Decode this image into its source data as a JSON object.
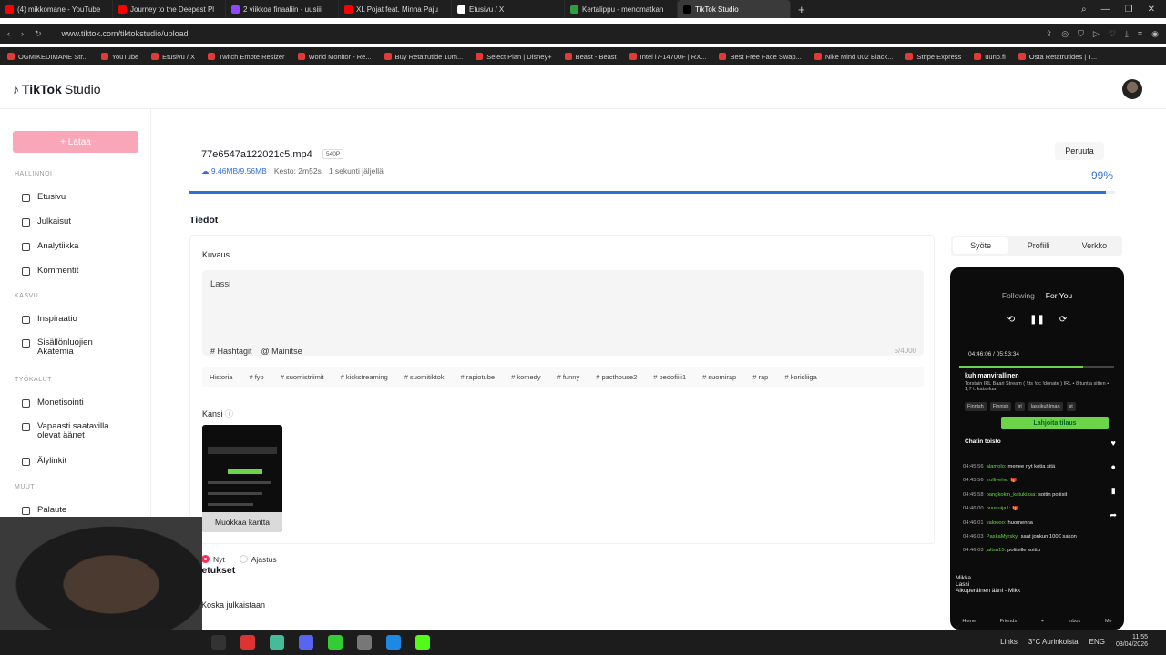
{
  "browser": {
    "tabs": [
      {
        "label": "(4) mikkomane - YouTube",
        "color": "#ff0000"
      },
      {
        "label": "Journey to the Deepest Pl",
        "color": "#ff0000"
      },
      {
        "label": "2 viikkoa finaaliin - uusiii",
        "color": "#9147ff"
      },
      {
        "label": "XL Pojat feat. Minna Paju",
        "color": "#ff0000"
      },
      {
        "label": "Etusivu / X",
        "color": "#ffffff"
      },
      {
        "label": "Kertalippu - menomatkan",
        "color": "#2e9e3f"
      },
      {
        "label": "TikTok Studio",
        "color": "#000000",
        "active": true
      }
    ],
    "url": "www.tiktok.com/tiktokstudio/upload",
    "bookmarks": [
      "OGMIKEDIMANE Str...",
      "YouTube",
      "Etusivu / X",
      "Twitch Emote Resizer",
      "World Monitor - Re...",
      "Buy Retatrutide 10m...",
      "Select Plan | Disney+",
      "Beast - Beast",
      "Intel i7-14700F | RX...",
      "Best Free Face Swap...",
      "Nike Mind 002 Black...",
      "Stripe Express",
      "uuno.fi",
      "Osta Retatrutides | T..."
    ]
  },
  "app": {
    "logo": "TikTok",
    "logo_suffix": "Studio",
    "upload_label": "+ Lataa",
    "sections": {
      "manage": "HALLINNOI",
      "grow": "KASVU",
      "tools": "TYÖKALUT",
      "other": "MUUT"
    },
    "nav": {
      "home": "Etusivu",
      "posts": "Julkaisut",
      "analytics": "Analytiikka",
      "comments": "Kommentit",
      "inspiration": "Inspiraatio",
      "academy": "Sisällönluojien Akatemia",
      "monetization": "Monetisointi",
      "sounds": "Vapaasti saatavilla olevat äänet",
      "smartlink": "Älylinkit",
      "feedback": "Palaute"
    }
  },
  "upload": {
    "file_name": "77e6547a122021c5.mp4",
    "badge": "540P",
    "size": "9.46MB/9.56MB",
    "duration": "Kesto: 2m52s",
    "remaining": "1 sekunti jäljellä",
    "cancel": "Peruuta",
    "progress_text": "99%",
    "progress": 0.99
  },
  "details": {
    "title": "Tiedot",
    "desc_label": "Kuvaus",
    "desc_value": "Lassi",
    "hashtags": "# Hashtagit",
    "mention": "@ Mainitse",
    "counter": "5/4000",
    "tags": [
      "Historia",
      "# fyp",
      "# suomistriimit",
      "# kickstreaming",
      "# suomitiktok",
      "# rapiotube",
      "# komedy",
      "# funny",
      "# pacthouse2",
      "# pedofiili1",
      "# suomirap",
      "# rap",
      "# korisliiga"
    ],
    "cover_label": "Kansi",
    "cover_edit": "Muokkaa kantta"
  },
  "settings": {
    "title": "Asetukset",
    "when_label": "Koska julkaistaan",
    "now": "Nyt",
    "schedule": "Ajastus"
  },
  "preview": {
    "tabs": [
      "Syöte",
      "Profiili",
      "Verkko"
    ],
    "following": "Following",
    "for_you": "For You",
    "time": "04:46:06 / 05:53:34",
    "progress": 0.8,
    "stream_name": "kuhlmanvirallinen",
    "stream_desc": "Torstain IRL Baari Stream ( !tts !dc !donate ) IRL • 8 tuntia sitten • 1,7 t. katselua",
    "stream_tags": [
      "Finnish",
      "Finnish",
      "irl",
      "lassikuhlman",
      "st"
    ],
    "support": "Lahjoita tilaus",
    "chat_title": "Chatin toisto",
    "chat": [
      {
        "t": "04:45:56",
        "u": "alamolo:",
        "m": "menee nyt kotia sitä"
      },
      {
        "t": "04:45:56",
        "u": "trollivehe:",
        "m": "🎁"
      },
      {
        "t": "04:45:58",
        "u": "bangkokin_katukissa:",
        "m": "soitin poliisit"
      },
      {
        "t": "04:46:00",
        "u": "puunuija1:",
        "m": "🎁"
      },
      {
        "t": "04:46:01",
        "u": "valoooo:",
        "m": "huomenna"
      },
      {
        "t": "04:46:03",
        "u": "PaskaMyrsky:",
        "m": "saat jonkun 100€ sakon"
      },
      {
        "t": "04:46:03",
        "u": "jaltsu15:",
        "m": "poliisille soittu"
      }
    ],
    "music_user": "Mikka",
    "music_user2": "Lassi",
    "music": "Alkuperäinen ääni - Mikk",
    "nav": [
      "Home",
      "Friends",
      "+",
      "Inbox",
      "Me"
    ]
  },
  "taskbar": {
    "links": "Links",
    "weather": "3°C Aurinkoista",
    "lang": "ENG",
    "time": "11.55",
    "date": "03/04/2026"
  }
}
